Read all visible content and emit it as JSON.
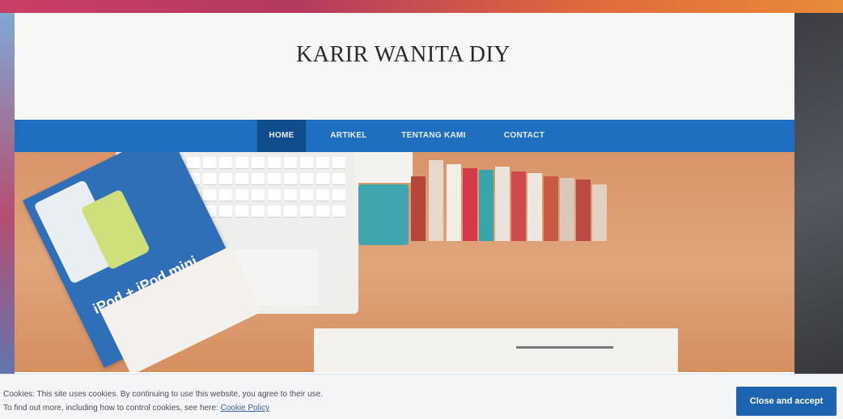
{
  "site": {
    "title": "KARIR WANITA DIY"
  },
  "nav": {
    "items": [
      {
        "label": "HOME",
        "active": true
      },
      {
        "label": "ARTIKEL",
        "active": false
      },
      {
        "label": "TENTANG KAMI",
        "active": false
      },
      {
        "label": "CONTACT",
        "active": false
      }
    ]
  },
  "hero": {
    "booklet_text": "iPod + iPod mini"
  },
  "cookie": {
    "line1": "Cookies: This site uses cookies. By continuing to use this website, you agree to their use.",
    "line2_prefix": "To find out more, including how to control cookies, see here:",
    "policy_link": "Cookie Policy",
    "accept_label": "Close and accept"
  },
  "colors": {
    "nav_bg": "#1f6fc0",
    "nav_active": "#0f4d8d",
    "accept_button": "#1d63b0"
  }
}
